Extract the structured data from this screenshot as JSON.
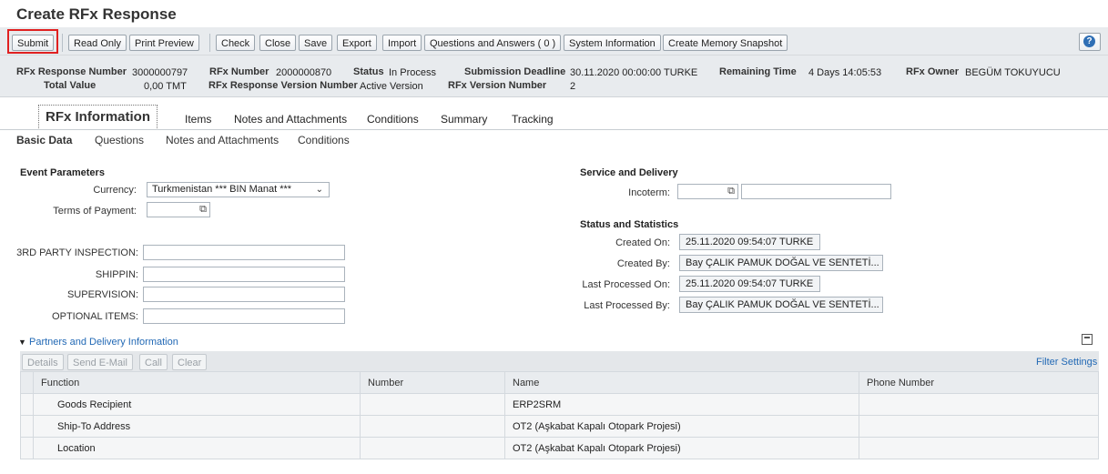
{
  "title": "Create RFx Response",
  "toolbar": {
    "buttons": [
      "Submit",
      "Read Only",
      "Print Preview",
      "Check",
      "Close",
      "Save",
      "Export",
      "Import",
      "Questions and Answers ( 0 )",
      "System Information",
      "Create Memory Snapshot"
    ],
    "help_icon": "help-icon"
  },
  "header": {
    "rfx_response_number_label": "RFx Response Number",
    "rfx_response_number": "3000000797",
    "total_value_label": "Total Value",
    "total_value": "0,00 TMT",
    "rfx_number_label": "RFx Number",
    "rfx_number": "2000000870",
    "version_label": "RFx Response Version Number",
    "version_value": "Active Version",
    "status_label": "Status",
    "status_value": "In Process",
    "deadline_label": "Submission Deadline",
    "deadline_value": "30.11.2020 00:00:00 TURKE",
    "rfx_version_label": "RFx Version Number",
    "rfx_version_value": "2",
    "remaining_label": "Remaining Time",
    "remaining_value": "4 Days 14:05:53",
    "owner_label": "RFx Owner",
    "owner_value": "BEGÜM TOKUYUCU"
  },
  "tabs": [
    "RFx Information",
    "Items",
    "Notes and Attachments",
    "Conditions",
    "Summary",
    "Tracking"
  ],
  "subtabs": [
    "Basic Data",
    "Questions",
    "Notes and Attachments",
    "Conditions"
  ],
  "event": {
    "title": "Event Parameters",
    "currency_label": "Currency:",
    "currency_value": "Turkmenistan *** BIN Manat ***",
    "payment_label": "Terms of Payment:"
  },
  "custom_fields": [
    "3RD PARTY INSPECTION:",
    "SHIPPIN:",
    "SUPERVISION:",
    "OPTIONAL ITEMS:"
  ],
  "service": {
    "title": "Service and Delivery",
    "incoterm_label": "Incoterm:"
  },
  "stats": {
    "title": "Status and Statistics",
    "created_on_label": "Created On:",
    "created_on": "25.11.2020 09:54:07 TURKE",
    "created_by_label": "Created By:",
    "created_by": "Bay ÇALIK PAMUK DOĞAL VE SENTETİ...",
    "last_on_label": "Last Processed On:",
    "last_on": "25.11.2020 09:54:07 TURKE",
    "last_by_label": "Last Processed By:",
    "last_by": "Bay ÇALIK PAMUK DOĞAL VE SENTETİ..."
  },
  "partners": {
    "title": "Partners and Delivery Information",
    "buttons": [
      "Details",
      "Send E-Mail",
      "Call",
      "Clear"
    ],
    "filter": "Filter Settings",
    "columns": [
      "Function",
      "Number",
      "Name",
      "Phone Number"
    ],
    "rows": [
      [
        "Goods Recipient",
        "",
        "ERP2SRM",
        ""
      ],
      [
        "Ship-To Address",
        "",
        "OT2 (Aşkabat Kapalı Otopark Projesi)",
        ""
      ],
      [
        "Location",
        "",
        "OT2 (Aşkabat Kapalı Otopark Projesi)",
        ""
      ]
    ]
  }
}
